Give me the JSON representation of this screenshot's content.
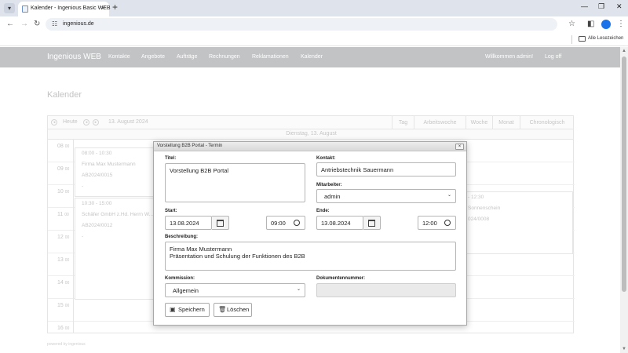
{
  "browser": {
    "tab_title": "Kalender - Ingenious Basic WEB",
    "url": "ingenious.de",
    "bookmarks_label": "Alle Lesezeichen"
  },
  "app": {
    "brand": "Ingenious WEB",
    "nav": [
      "Kontakte",
      "Angebote",
      "Aufträge",
      "Rechnungen",
      "Reklamationen",
      "Kalender"
    ],
    "welcome": "Willkommen admin!",
    "logout": "Log off",
    "page_title": "Kalender",
    "footer": "powered by ingenious"
  },
  "calendar": {
    "today_label": "Heute",
    "date_label": "13. August 2024",
    "views": [
      "Tag",
      "Arbeitswoche",
      "Woche",
      "Monat",
      "Chronologisch"
    ],
    "day_header": "Dienstag, 13. August",
    "hours": [
      "08",
      "09",
      "10",
      "11",
      "12",
      "13",
      "14",
      "15",
      "16"
    ],
    "hour_suffix": "00",
    "events": [
      {
        "lines": [
          "08:00 - 10:30",
          "Firma Max Mustermann",
          "AB2024/0015",
          "-"
        ]
      },
      {
        "lines": [
          "10:30 - 15:00",
          "Schäfer GmbH z.Hd. Herrn W...",
          "AB2024/0012",
          "-"
        ]
      },
      {
        "lines": [
          "- 12:30",
          "Sonnenschein",
          "024/0008"
        ]
      }
    ]
  },
  "modal": {
    "title": "Vorstellung B2B Portal - Termin",
    "close": "×",
    "labels": {
      "titel": "Titel:",
      "kontakt": "Kontakt:",
      "mitarbeiter": "Mitarbeiter:",
      "start": "Start:",
      "ende": "Ende:",
      "beschreibung": "Beschreibung:",
      "kommission": "Kommission:",
      "dokumentennummer": "Dokumentennummer:"
    },
    "values": {
      "titel": "Vorstellung B2B Portal",
      "kontakt": "Antriebstechnik Sauermann",
      "mitarbeiter": "admin",
      "start_date": "13.08.2024",
      "start_time": "09:00",
      "end_date": "13.08.2024",
      "end_time": "12:00",
      "beschreibung_line1": "Firma Max Mustermann",
      "beschreibung_line2": "Präsentation und Schulung der Funktionen des B2B",
      "kommission": "Allgemein",
      "dokumentennummer": ""
    },
    "buttons": {
      "save": "Speichern",
      "delete": "Löschen"
    }
  }
}
